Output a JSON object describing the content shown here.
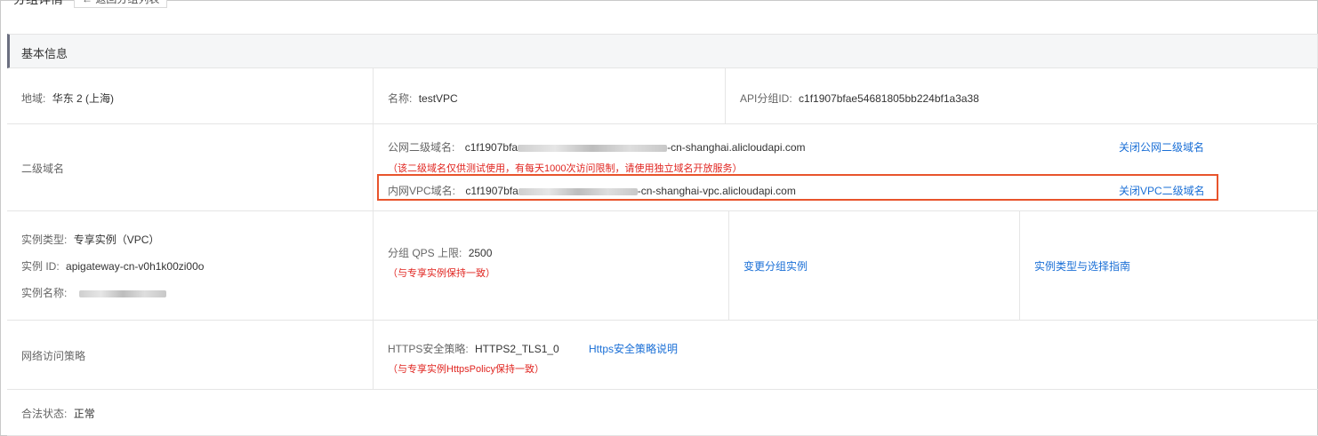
{
  "topbar": {
    "title": "分组详情",
    "back_label": "← 返回分组列表"
  },
  "section": {
    "title": "基本信息"
  },
  "row1": {
    "region_label": "地域:",
    "region_value": "华东 2 (上海)",
    "name_label": "名称:",
    "name_value": "testVPC",
    "group_id_label": "API分组ID:",
    "group_id_value": "c1f1907bfae54681805bb224bf1a3a38"
  },
  "row2": {
    "label": "二级域名",
    "public_label": "公网二级域名:",
    "public_prefix": "c1f1907bfa",
    "public_suffix": "-cn-shanghai.alicloudapi.com",
    "public_note": "（该二级域名仅供测试使用，有每天1000次访问限制，请使用独立域名开放服务）",
    "public_action": "关闭公网二级域名",
    "vpc_label": "内网VPC域名:",
    "vpc_prefix": "c1f1907bfa",
    "vpc_suffix": "-cn-shanghai-vpc.alicloudapi.com",
    "vpc_action": "关闭VPC二级域名"
  },
  "row3": {
    "type_label": "实例类型:",
    "type_value": "专享实例（VPC）",
    "id_label": "实例 ID:",
    "id_value": "apigateway-cn-v0h1k00zi00o",
    "instance_name_label": "实例名称:",
    "qps_label": "分组 QPS 上限:",
    "qps_value": "2500",
    "qps_note": "（与专享实例保持一致）",
    "change_action": "变更分组实例",
    "guide_action": "实例类型与选择指南"
  },
  "row4": {
    "label": "网络访问策略",
    "https_label": "HTTPS安全策略:",
    "https_value": "HTTPS2_TLS1_0",
    "https_link": "Https安全策略说明",
    "https_note": "（与专享实例HttpsPolicy保持一致）"
  },
  "row5": {
    "status_label": "合法状态:",
    "status_value": "正常"
  },
  "colors": {
    "link": "#1a6fd6",
    "warning": "#e0241f",
    "highlight": "#e8542c"
  }
}
